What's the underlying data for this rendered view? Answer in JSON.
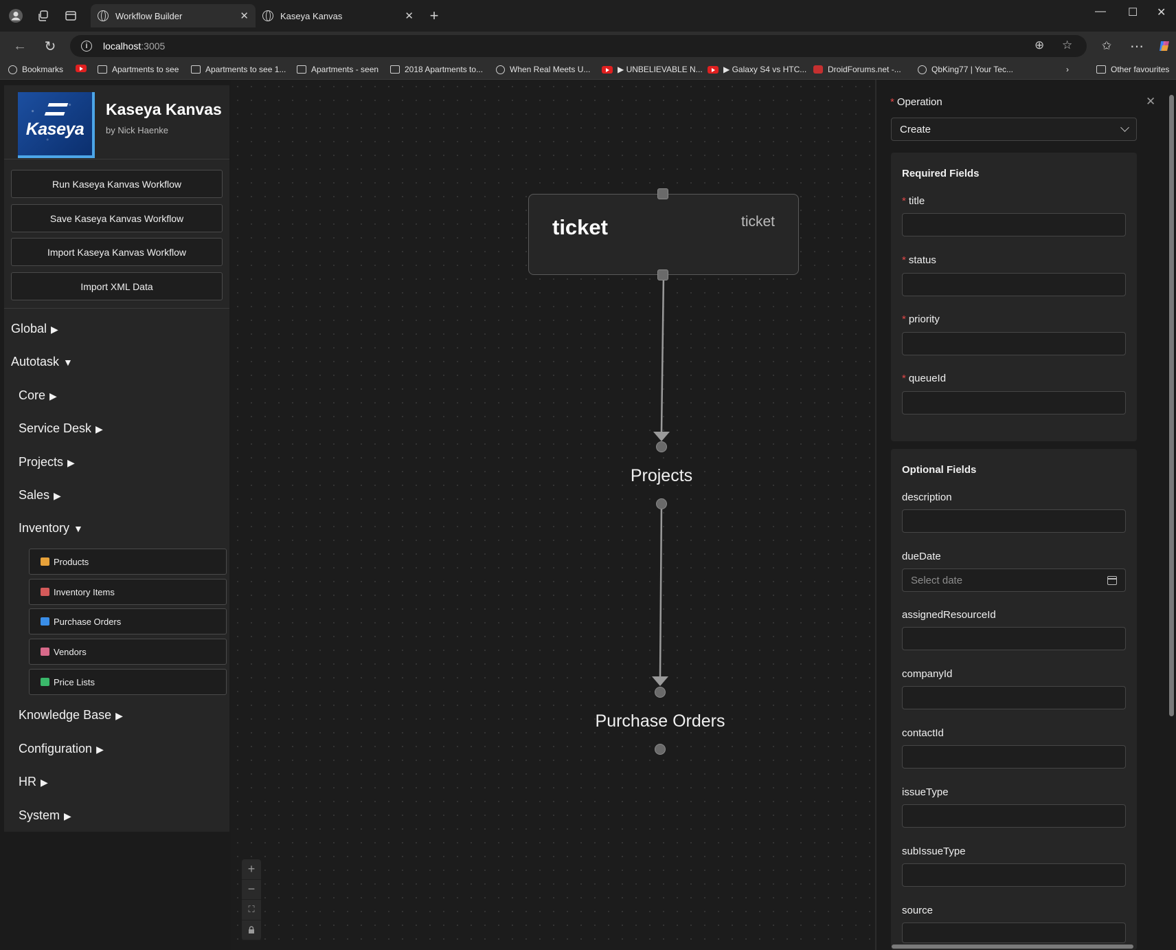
{
  "browser": {
    "tabs": [
      {
        "title": "Workflow Builder"
      },
      {
        "title": "Kaseya Kanvas"
      }
    ],
    "url": {
      "host": "localhost",
      "port": ":3005"
    },
    "bookmarks": [
      {
        "label": "Bookmarks",
        "icon": "globe-icon"
      },
      {
        "label": "Apartments to see",
        "icon": "folder-icon"
      },
      {
        "label": "Apartments to see 1...",
        "icon": "folder-icon"
      },
      {
        "label": "Apartments - seen",
        "icon": "folder-icon"
      },
      {
        "label": "2018 Apartments to...",
        "icon": "folder-icon"
      },
      {
        "label": "When Real Meets U...",
        "icon": "globe-icon"
      },
      {
        "label": "▶ UNBELIEVABLE N...",
        "icon": "youtube-icon"
      },
      {
        "label": "▶ Galaxy S4 vs HTC...",
        "icon": "youtube-icon"
      },
      {
        "label": "DroidForums.net -...",
        "icon": "droidforums-icon"
      },
      {
        "label": "QbKing77 | Your Tec...",
        "icon": "globe-icon"
      }
    ],
    "other_favourites": "Other favourites"
  },
  "sidebar": {
    "brand_title": "Kaseya Kanvas",
    "brand_sub": "by Nick Haenke",
    "logo_word": "Kaseya",
    "buttons": [
      {
        "label": "Run Kaseya Kanvas Workflow"
      },
      {
        "label": "Save Kaseya Kanvas Workflow"
      },
      {
        "label": "Import Kaseya Kanvas Workflow"
      },
      {
        "label": "Import XML Data"
      }
    ],
    "menu": {
      "global": "Global",
      "autotask": "Autotask",
      "core": "Core",
      "service_desk": "Service Desk",
      "projects": "Projects",
      "sales": "Sales",
      "inventory": "Inventory",
      "knowledge_base": "Knowledge Base",
      "configuration": "Configuration",
      "hr": "HR",
      "system": "System"
    },
    "inventory_items": [
      {
        "label": "Products",
        "color": "#e8a23a"
      },
      {
        "label": "Inventory Items",
        "color": "#d45a5a"
      },
      {
        "label": "Purchase Orders",
        "color": "#3a8ee8"
      },
      {
        "label": "Vendors",
        "color": "#d86a8a"
      },
      {
        "label": "Price Lists",
        "color": "#3ab86a"
      }
    ]
  },
  "canvas": {
    "node": {
      "title": "ticket",
      "type": "ticket"
    },
    "labels": {
      "projects": "Projects",
      "purchase_orders": "Purchase Orders"
    }
  },
  "panel": {
    "operation_label": "Operation",
    "operation_value": "Create",
    "required_title": "Required Fields",
    "required_fields": [
      "title",
      "status",
      "priority",
      "queueId"
    ],
    "optional_title": "Optional Fields",
    "optional_fields": [
      "description",
      "dueDate",
      "assignedResourceId",
      "companyId",
      "contactId",
      "issueType",
      "subIssueType",
      "source"
    ],
    "date_placeholder": "Select date"
  }
}
